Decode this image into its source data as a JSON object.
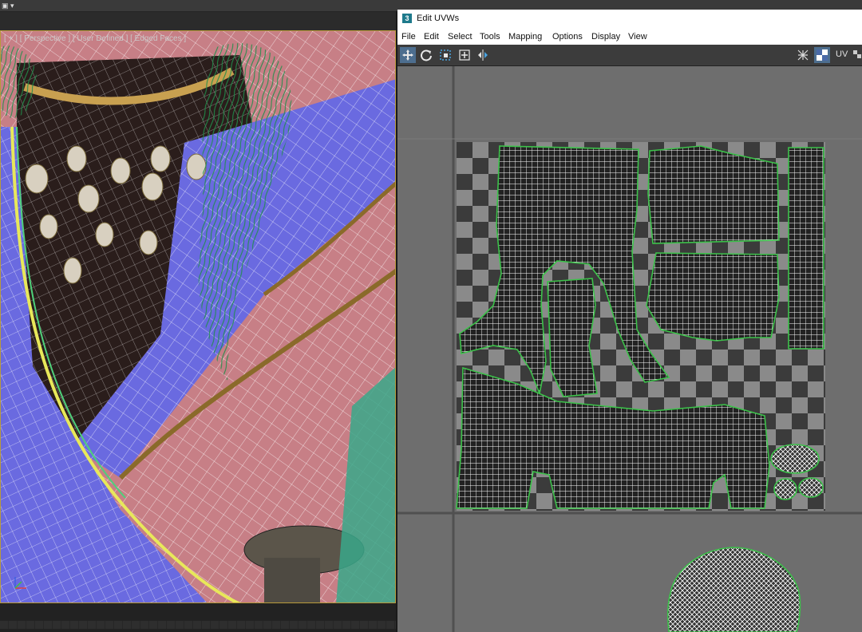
{
  "viewport": {
    "label": "[ + ] [ Perspective ] [ User Defined ] [ Edged Faces ]"
  },
  "uv_editor": {
    "window_title": "Edit UVWs",
    "app_icon_glyph": "3",
    "menu": [
      "File",
      "Edit",
      "Select",
      "Tools",
      "Mapping",
      "Options",
      "Display",
      "View"
    ],
    "toolbar": {
      "tools": [
        "move-icon",
        "rotate-icon",
        "scale-icon",
        "freeform-icon",
        "mirror-icon"
      ],
      "right_tools": [
        "checker-pattern-icon",
        "texture-toggle-icon"
      ],
      "uv_label": "UV"
    }
  },
  "colors": {
    "uv_shell_outline": "#3cc24a",
    "active_tool": "#4d6e8f",
    "viewport_border": "#b89a3b",
    "hair_mesh": "#1f8f4a",
    "cloth_blue": "#6a6ae0",
    "cloth_pink": "#d88a8a"
  }
}
